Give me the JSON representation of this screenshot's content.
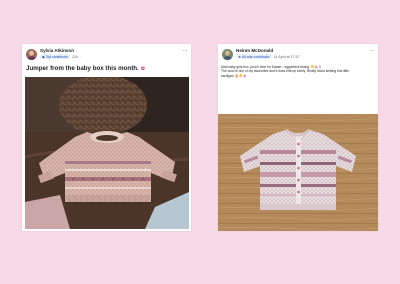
{
  "posts": [
    {
      "user_name": "Sylvia Atkinson",
      "badge": "Top contributor",
      "time": "22h",
      "text": "Jumper from the baby box this month.",
      "emoji_icon": "rose-icon"
    },
    {
      "user_name": "Neinm McDonald",
      "badge": "All-star contributor",
      "time": "14 April at 17:57",
      "text_line1": "Aimi baby girls box, just in time for Easter - eggcellent timing 🐣🌸🐰",
      "text_line2": "The wool is one of my favourites and it does knit up lovely. Really loved knitting this little",
      "text_line3": "cardigan 🥚🐣🌸"
    }
  ],
  "colors": {
    "background": "#f8d9e7",
    "card": "#ffffff",
    "badge_bg": "#e7f0fb",
    "badge_text": "#1f4fa3"
  }
}
